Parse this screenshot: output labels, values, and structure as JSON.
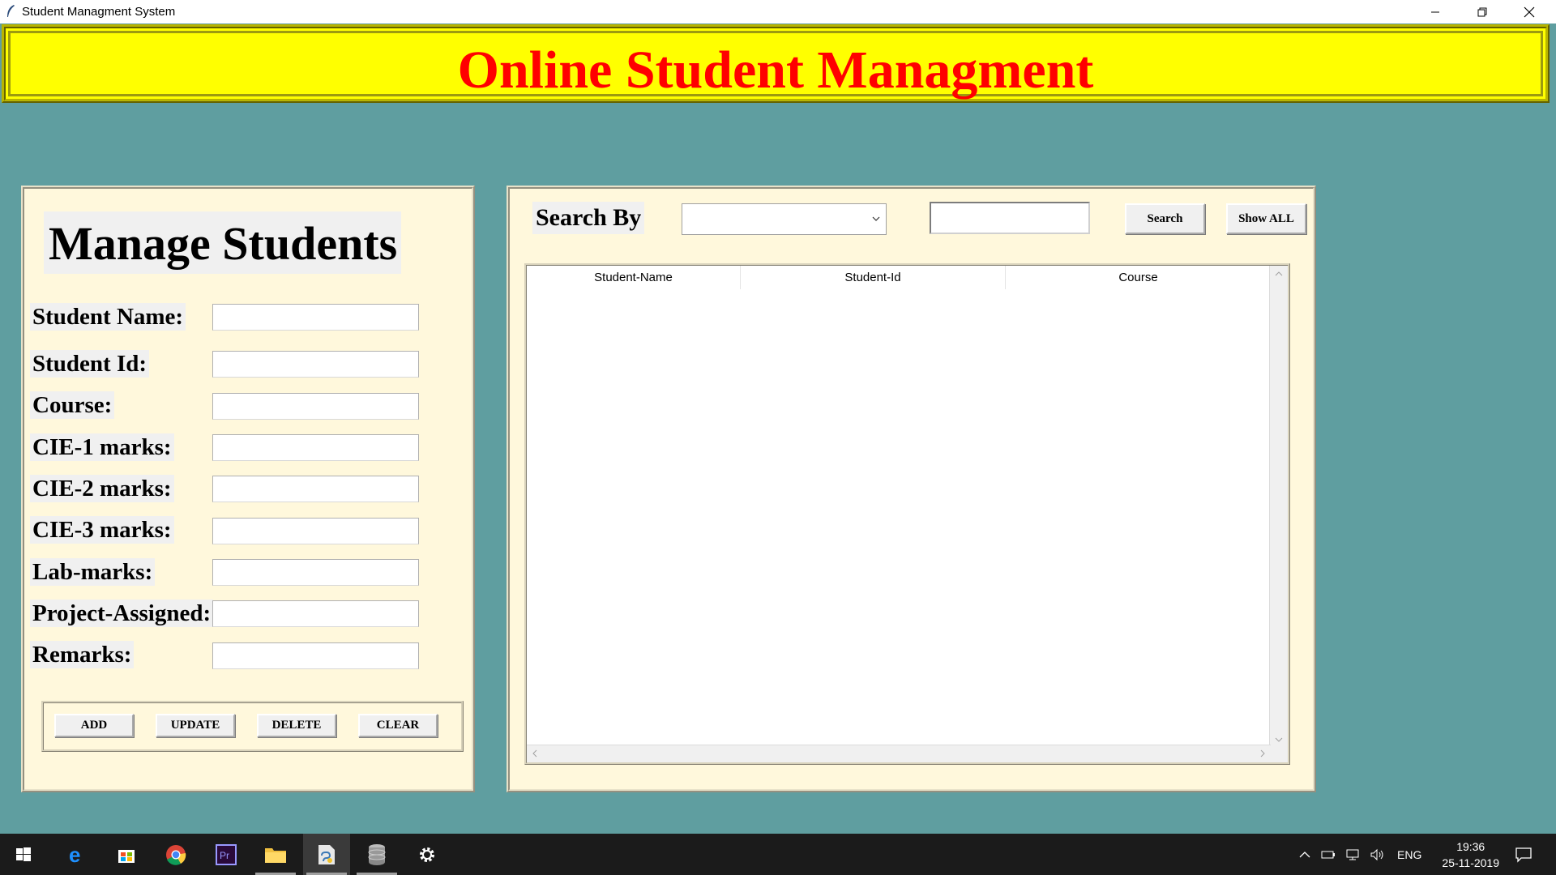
{
  "window": {
    "title": "Student Managment System"
  },
  "banner": {
    "title": "Online Student Managment"
  },
  "manage": {
    "title": "Manage Students",
    "fields": [
      {
        "label": "Student Name:",
        "value": ""
      },
      {
        "label": "Student Id:",
        "value": ""
      },
      {
        "label": "Course:",
        "value": ""
      },
      {
        "label": "CIE-1 marks:",
        "value": ""
      },
      {
        "label": "CIE-2 marks:",
        "value": ""
      },
      {
        "label": "CIE-3 marks:",
        "value": ""
      },
      {
        "label": "Lab-marks:",
        "value": ""
      },
      {
        "label": "Project-Assigned:",
        "value": ""
      },
      {
        "label": "Remarks:",
        "value": ""
      }
    ],
    "buttons": {
      "add": "ADD",
      "update": "UPDATE",
      "delete": "DELETE",
      "clear": "CLEAR"
    }
  },
  "detail": {
    "search_label": "Search By",
    "search_by_selected": "",
    "search_text": "",
    "search_button": "Search",
    "show_all_button": "Show ALL",
    "columns": [
      "Student-Name",
      "Student-Id",
      "Course"
    ],
    "rows": []
  },
  "taskbar": {
    "icons": [
      "windows-start-icon",
      "edge-icon",
      "store-icon",
      "chrome-icon",
      "premiere-icon",
      "file-explorer-icon",
      "python-idle-icon",
      "database-icon",
      "settings-icon"
    ],
    "language": "ENG",
    "time": "19:36",
    "date": "25-11-2019"
  },
  "colors": {
    "background": "#5f9ea0",
    "banner": "#ffff00",
    "banner_text": "#ff0000",
    "panel": "#fff8dc"
  }
}
